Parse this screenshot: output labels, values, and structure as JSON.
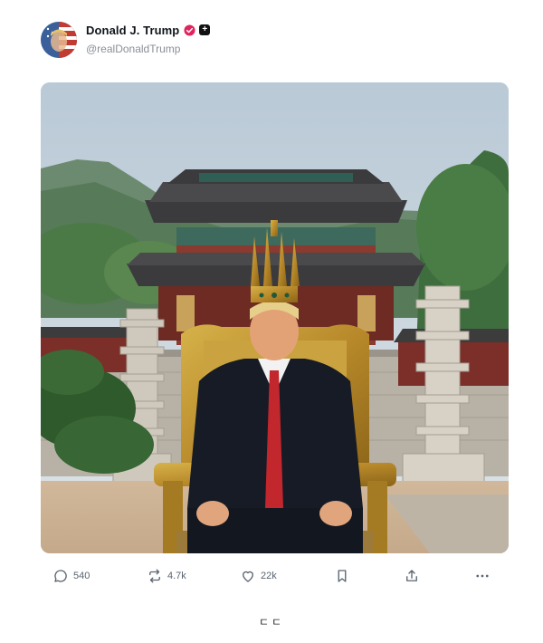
{
  "author": {
    "display_name": "Donald J. Trump",
    "handle": "@realDonaldTrump"
  },
  "badges": [
    "verified-badge-icon",
    "plus-badge-icon"
  ],
  "media": {
    "kind": "photo",
    "description_icon": "image"
  },
  "actions": {
    "reply_count": "540",
    "repost_count": "4.7k",
    "like_count": "22k"
  },
  "footer": {
    "mark": "ㄷㄷ"
  },
  "colors": {
    "verified": "#e0245e",
    "icon_gray": "#5b6470",
    "handle_gray": "#8a8f96"
  }
}
